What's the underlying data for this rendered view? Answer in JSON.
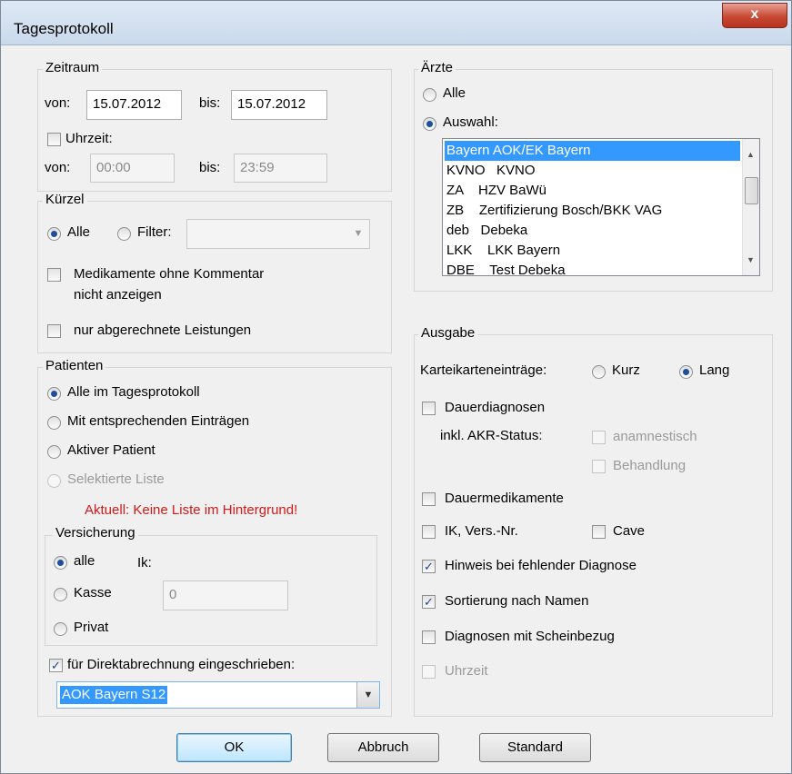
{
  "window": {
    "title": "Tagesprotokoll",
    "close_glyph": "x"
  },
  "zeitraum": {
    "title": "Zeitraum",
    "von_label": "von:",
    "von_value": "15.07.2012",
    "bis_label": "bis:",
    "bis_value": "15.07.2012",
    "uhrzeit_label": "Uhrzeit:",
    "von2_label": "von:",
    "von2_value": "00:00",
    "bis2_label": "bis:",
    "bis2_value": "23:59"
  },
  "kuerzel": {
    "title": "Kürzel",
    "alle_label": "Alle",
    "filter_label": "Filter:",
    "filter_value": "",
    "medikamente_line1": "Medikamente ohne Kommentar",
    "medikamente_line2": "nicht anzeigen",
    "nur_abgerechnete": "nur abgerechnete Leistungen"
  },
  "patienten": {
    "title": "Patienten",
    "options": [
      "Alle im Tagesprotokoll",
      "Mit entsprechenden Einträgen",
      "Aktiver Patient",
      "Selektierte Liste"
    ],
    "warning": "Aktuell: Keine Liste im Hintergrund!",
    "versicherung": {
      "title": "Versicherung",
      "alle": "alle",
      "ik_label": "Ik:",
      "kasse": "Kasse",
      "kasse_value": "0",
      "privat": "Privat"
    },
    "direkt_label": "für Direktabrechnung eingeschrieben:",
    "direkt_value": "AOK Bayern S12"
  },
  "aerzte": {
    "title": "Ärzte",
    "alle": "Alle",
    "auswahl": "Auswahl:",
    "items": [
      "Bayern AOK/EK Bayern",
      "KVNO   KVNO",
      "ZA    HZV BaWü",
      "ZB    Zertifizierung Bosch/BKK VAG",
      "deb   Debeka",
      "LKK    LKK Bayern",
      "DBE    Test Debeka"
    ]
  },
  "ausgabe": {
    "title": "Ausgabe",
    "kartei_label": "Karteikarteneinträge:",
    "kurz": "Kurz",
    "lang": "Lang",
    "dauerdiagnosen": "Dauerdiagnosen",
    "akr_label": "inkl. AKR-Status:",
    "anamnestisch": "anamnestisch",
    "behandlung": "Behandlung",
    "dauermedikamente": "Dauermedikamente",
    "ik_versnr": "IK, Vers.-Nr.",
    "cave": "Cave",
    "hinweis": "Hinweis bei fehlender Diagnose",
    "sortierung": "Sortierung nach Namen",
    "diagnosen_schein": "Diagnosen mit Scheinbezug",
    "uhrzeit": "Uhrzeit"
  },
  "buttons": {
    "ok": "OK",
    "abbruch": "Abbruch",
    "standard": "Standard"
  },
  "glyphs": {
    "check": "✓",
    "down": "▼",
    "up": "▲"
  }
}
